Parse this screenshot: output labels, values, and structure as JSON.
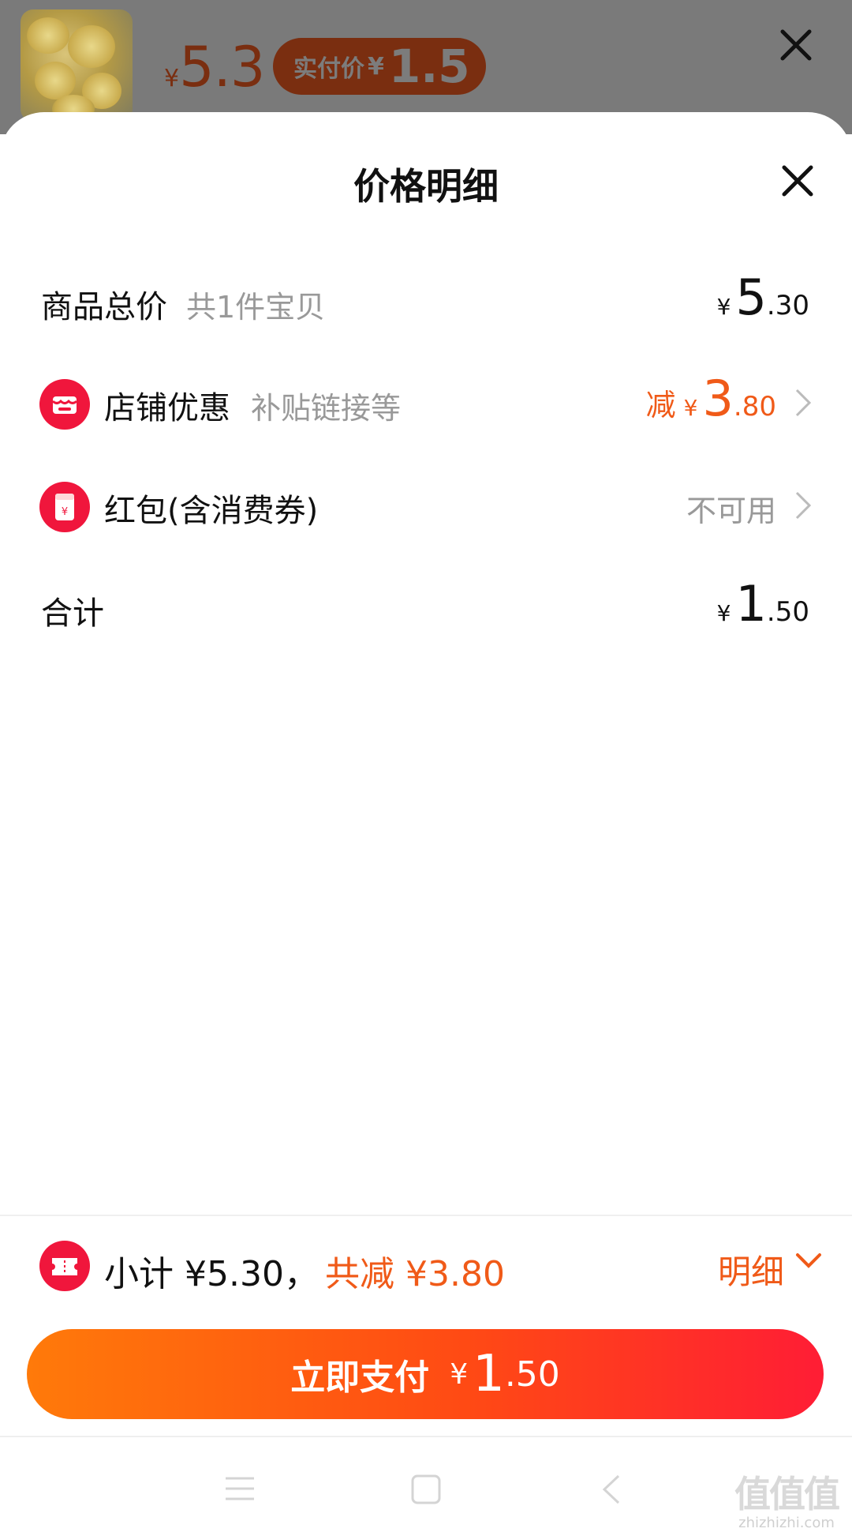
{
  "background": {
    "price_currency": "¥",
    "price_value": "5.3",
    "pill_label": "实付价",
    "pill_currency": "¥",
    "pill_value": "1.5",
    "close_icon": "close-icon"
  },
  "sheet": {
    "title": "价格明细",
    "close_icon": "close-icon",
    "rows": {
      "total": {
        "label": "商品总价",
        "sub": "共1件宝贝",
        "currency": "¥",
        "int": "5",
        "dec": ".30"
      },
      "shop": {
        "icon": "store-icon",
        "label": "店铺优惠",
        "sub": "补贴链接等",
        "prefix": "减",
        "currency": "¥",
        "int": "3",
        "dec": ".80",
        "chevron": "chevron-right-icon"
      },
      "redpacket": {
        "icon": "red-envelope-icon",
        "label": "红包(含消费券)",
        "value": "不可用",
        "chevron": "chevron-right-icon"
      },
      "sum": {
        "label": "合计",
        "currency": "¥",
        "int": "1",
        "dec": ".50"
      }
    }
  },
  "footer": {
    "icon": "coupon-icon",
    "subtotal": "小计 ¥5.30，",
    "saved": "共减 ¥3.80",
    "detail_label": "明细",
    "detail_chevron": "chevron-down-icon",
    "pay_label": "立即支付",
    "pay_currency": "¥",
    "pay_int": "1",
    "pay_dec": ".50"
  },
  "navbar": {
    "menu_icon": "menu-icon",
    "home_icon": "home-square-icon",
    "back_icon": "back-icon"
  },
  "watermark": {
    "logo": "值值值",
    "url": "zhizhizhi.com"
  },
  "colors": {
    "accent": "#f05a18",
    "badge": "#f0163c",
    "button_start": "#ff7a0a",
    "button_end": "#ff1d35"
  }
}
